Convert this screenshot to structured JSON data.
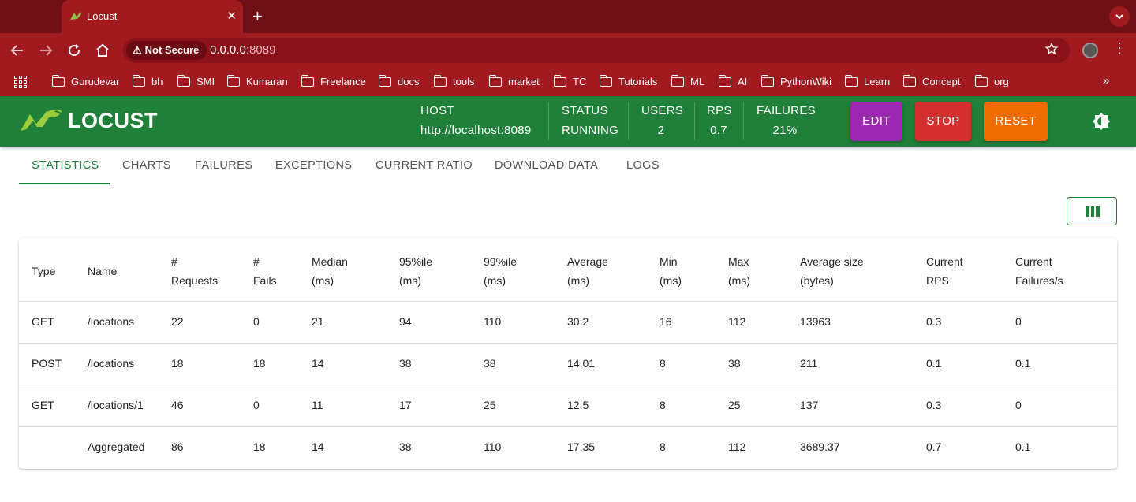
{
  "browser": {
    "tab_title": "Locust",
    "close_glyph": "✕",
    "new_tab_glyph": "+",
    "security_label": "Not Secure",
    "url_host": "0.0.0.0",
    "url_port": ":8089",
    "bookmarks": [
      "Gurudevar",
      "bh",
      "SMI",
      "Kumaran",
      "Freelance",
      "docs",
      "tools",
      "market",
      "TC",
      "Tutorials",
      "ML",
      "AI",
      "PythonWiki",
      "Learn",
      "Concept",
      "org"
    ],
    "more_glyph": "»"
  },
  "header": {
    "logo_text": "LOCUST",
    "host_label": "HOST",
    "host_value": "http://localhost:8089",
    "status_label": "STATUS",
    "status_value": "RUNNING",
    "users_label": "USERS",
    "users_value": "2",
    "rps_label": "RPS",
    "rps_value": "0.7",
    "failures_label": "FAILURES",
    "failures_value": "21%",
    "edit_label": "EDIT",
    "stop_label": "STOP",
    "reset_label": "RESET",
    "colors": {
      "bar": "#1e8039",
      "edit": "#9c27b0",
      "stop": "#d32f2f",
      "reset": "#ef6c00"
    }
  },
  "tabs": [
    "STATISTICS",
    "CHARTS",
    "FAILURES",
    "EXCEPTIONS",
    "CURRENT RATIO",
    "DOWNLOAD DATA",
    "LOGS"
  ],
  "table": {
    "headers": [
      [
        "Type",
        ""
      ],
      [
        "Name",
        ""
      ],
      [
        "#",
        "Requests"
      ],
      [
        "#",
        "Fails"
      ],
      [
        "Median",
        "(ms)"
      ],
      [
        "95%ile",
        "(ms)"
      ],
      [
        "99%ile",
        "(ms)"
      ],
      [
        "Average",
        "(ms)"
      ],
      [
        "Min",
        "(ms)"
      ],
      [
        "Max",
        "(ms)"
      ],
      [
        "Average size",
        "(bytes)"
      ],
      [
        "Current",
        "RPS"
      ],
      [
        "Current",
        "Failures/s"
      ]
    ],
    "rows": [
      [
        "GET",
        "/locations",
        "22",
        "0",
        "21",
        "94",
        "110",
        "30.2",
        "16",
        "112",
        "13963",
        "0.3",
        "0"
      ],
      [
        "POST",
        "/locations",
        "18",
        "18",
        "14",
        "38",
        "38",
        "14.01",
        "8",
        "38",
        "211",
        "0.1",
        "0.1"
      ],
      [
        "GET",
        "/locations/1",
        "46",
        "0",
        "11",
        "17",
        "25",
        "12.5",
        "8",
        "25",
        "137",
        "0.3",
        "0"
      ],
      [
        "",
        "Aggregated",
        "86",
        "18",
        "14",
        "38",
        "110",
        "17.35",
        "8",
        "112",
        "3689.37",
        "0.7",
        "0.1"
      ]
    ]
  }
}
